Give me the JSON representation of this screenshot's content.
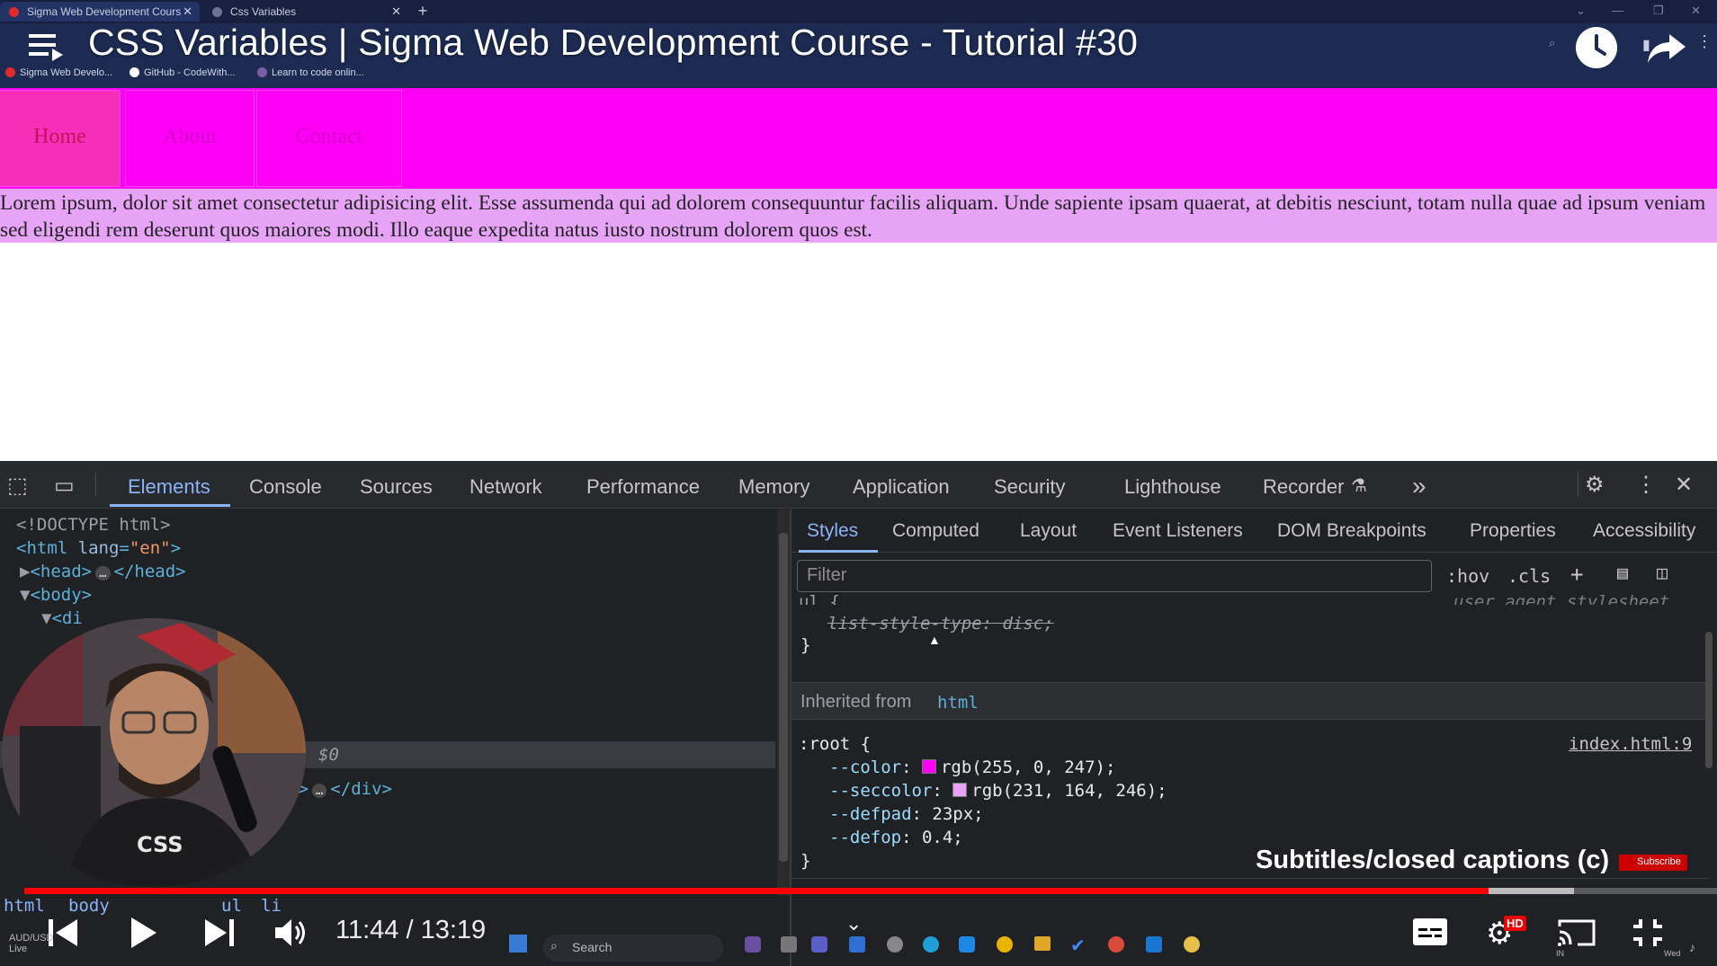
{
  "browser": {
    "tabs": [
      {
        "label": "Sigma Web Development Cours",
        "favicon_color": "#e02a2a"
      },
      {
        "label": "Css Variables",
        "favicon_color": "#6b7490"
      }
    ],
    "bookmarks": [
      {
        "label": "Sigma Web Develo...",
        "color": "#e02a2a"
      },
      {
        "label": "GitHub - CodeWith...",
        "color": "#ffffff"
      },
      {
        "label": "Learn to code onlin...",
        "color": "#7a5fa8"
      }
    ]
  },
  "video": {
    "title": "CSS Variables | Sigma Web Development Course - Tutorial #30",
    "time": "11:44 / 13:19",
    "progress_fraction": 0.865,
    "caption_tooltip": "Subtitles/closed captions (c)",
    "subscribe_label": "Subscribe",
    "hd_badge": "HD"
  },
  "page": {
    "nav": [
      "Home",
      "About",
      "Contact"
    ],
    "paragraph": "Lorem ipsum, dolor sit amet consectetur adipisicing elit. Esse assumenda qui ad dolorem consequuntur facilis aliquam. Unde sapiente ipsam quaerat, at debitis nesciunt, totam nulla quae ad ipsum veniam sed eligendi rem deserunt quos maiores modi. Illo eaque expedita natus iusto nostrum dolorem quos est.",
    "nav_color": "#ff00f7",
    "paragraph_bg": "#e7a4f6"
  },
  "devtools": {
    "tabs": [
      "Elements",
      "Console",
      "Sources",
      "Network",
      "Performance",
      "Memory",
      "Application",
      "Security",
      "Lighthouse",
      "Recorder"
    ],
    "dom": {
      "doctype": "<!DOCTYPE html>",
      "html_open": "<html ",
      "html_attr": "lang",
      "html_val": "\"en\"",
      "head_open": "<head>",
      "head_close": "</head>",
      "body_open": "<body>",
      "div_close": "</div>",
      "selected_marker": "$0",
      "ellipsis": "…"
    },
    "breadcrumbs": [
      "html",
      "body",
      "ul",
      "li"
    ],
    "styles_tabs": [
      "Styles",
      "Computed",
      "Layout",
      "Event Listeners",
      "DOM Breakpoints",
      "Properties",
      "Accessibility"
    ],
    "filter_placeholder": "Filter",
    "hov": ":hov",
    "cls": ".cls",
    "ua_rule": {
      "selector_partial": "ul {",
      "source": "user agent stylesheet",
      "prop": "list-style-type",
      "value": "disc;",
      "close": "}"
    },
    "inherited_label": "Inherited from",
    "inherited_tag": "html",
    "root_rule": {
      "selector": ":root {",
      "source": "index.html:9",
      "props": [
        {
          "name": "--color",
          "value": "rgb(255, 0, 247);",
          "swatch": "#ff00f7"
        },
        {
          "name": "--seccolor",
          "value": "rgb(231, 164, 246);",
          "swatch": "#e7a4f6"
        },
        {
          "name": "--defpad",
          "value": "23px;"
        },
        {
          "name": "--defop",
          "value": "0.4;"
        }
      ],
      "close": "}"
    }
  },
  "taskbar": {
    "search_placeholder": "Search",
    "weather": "AUD/USD",
    "weather_sub": "Live",
    "tray_lang": "IN",
    "tray_day": "Wed"
  }
}
